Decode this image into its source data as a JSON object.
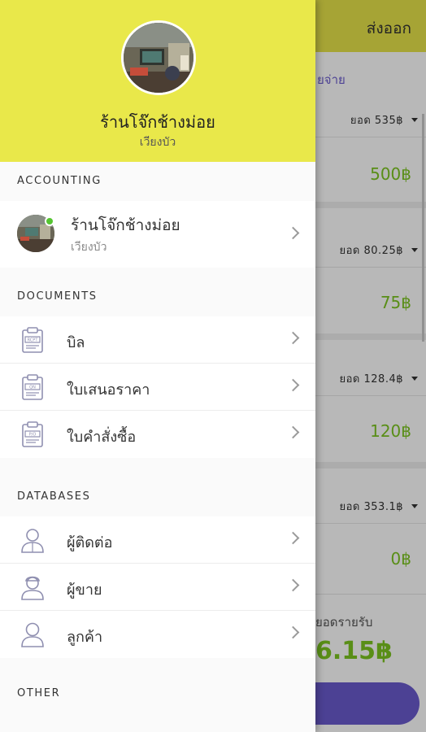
{
  "background": {
    "export_label": "ส่งออก",
    "tab_label": "ยจ่าย",
    "cards": [
      {
        "total_label": "ยอด 535฿",
        "amount": "500฿"
      },
      {
        "total_label": "ยอด 80.25฿",
        "amount": "75฿"
      },
      {
        "total_label": "ยอด 128.4฿",
        "amount": "120฿"
      },
      {
        "total_label": "ยอด 353.1฿",
        "amount": "0฿"
      }
    ],
    "summary_label": "ยอดรายรับ",
    "summary_total": "6.15฿"
  },
  "drawer": {
    "shop_name": "ร้านโจ๊กช้างม่อย",
    "shop_location": "เวียงบัว",
    "sections": {
      "accounting": "ACCOUNTING",
      "documents": "DOCUMENTS",
      "databases": "DATABASES",
      "other": "OTHER"
    },
    "account": {
      "name": "ร้านโจ๊กช้างม่อย",
      "location": "เวียงบัว"
    },
    "documents": [
      {
        "label": "บิล",
        "icon": "receipt-clipboard-icon",
        "tag": "RCPT"
      },
      {
        "label": "ใบเสนอราคา",
        "icon": "quotation-clipboard-icon",
        "tag": "QN"
      },
      {
        "label": "ใบคำสั่งซื้อ",
        "icon": "purchase-order-clipboard-icon",
        "tag": "P/O"
      }
    ],
    "databases": [
      {
        "label": "ผู้ติดต่อ",
        "icon": "contact-person-icon"
      },
      {
        "label": "ผู้ขาย",
        "icon": "seller-person-icon"
      },
      {
        "label": "ลูกค้า",
        "icon": "customer-person-icon"
      }
    ]
  },
  "colors": {
    "header_yellow": "#e9e84a",
    "accent_purple": "#6a5acd",
    "amount_green": "#7cc520",
    "online_green": "#55c531"
  }
}
